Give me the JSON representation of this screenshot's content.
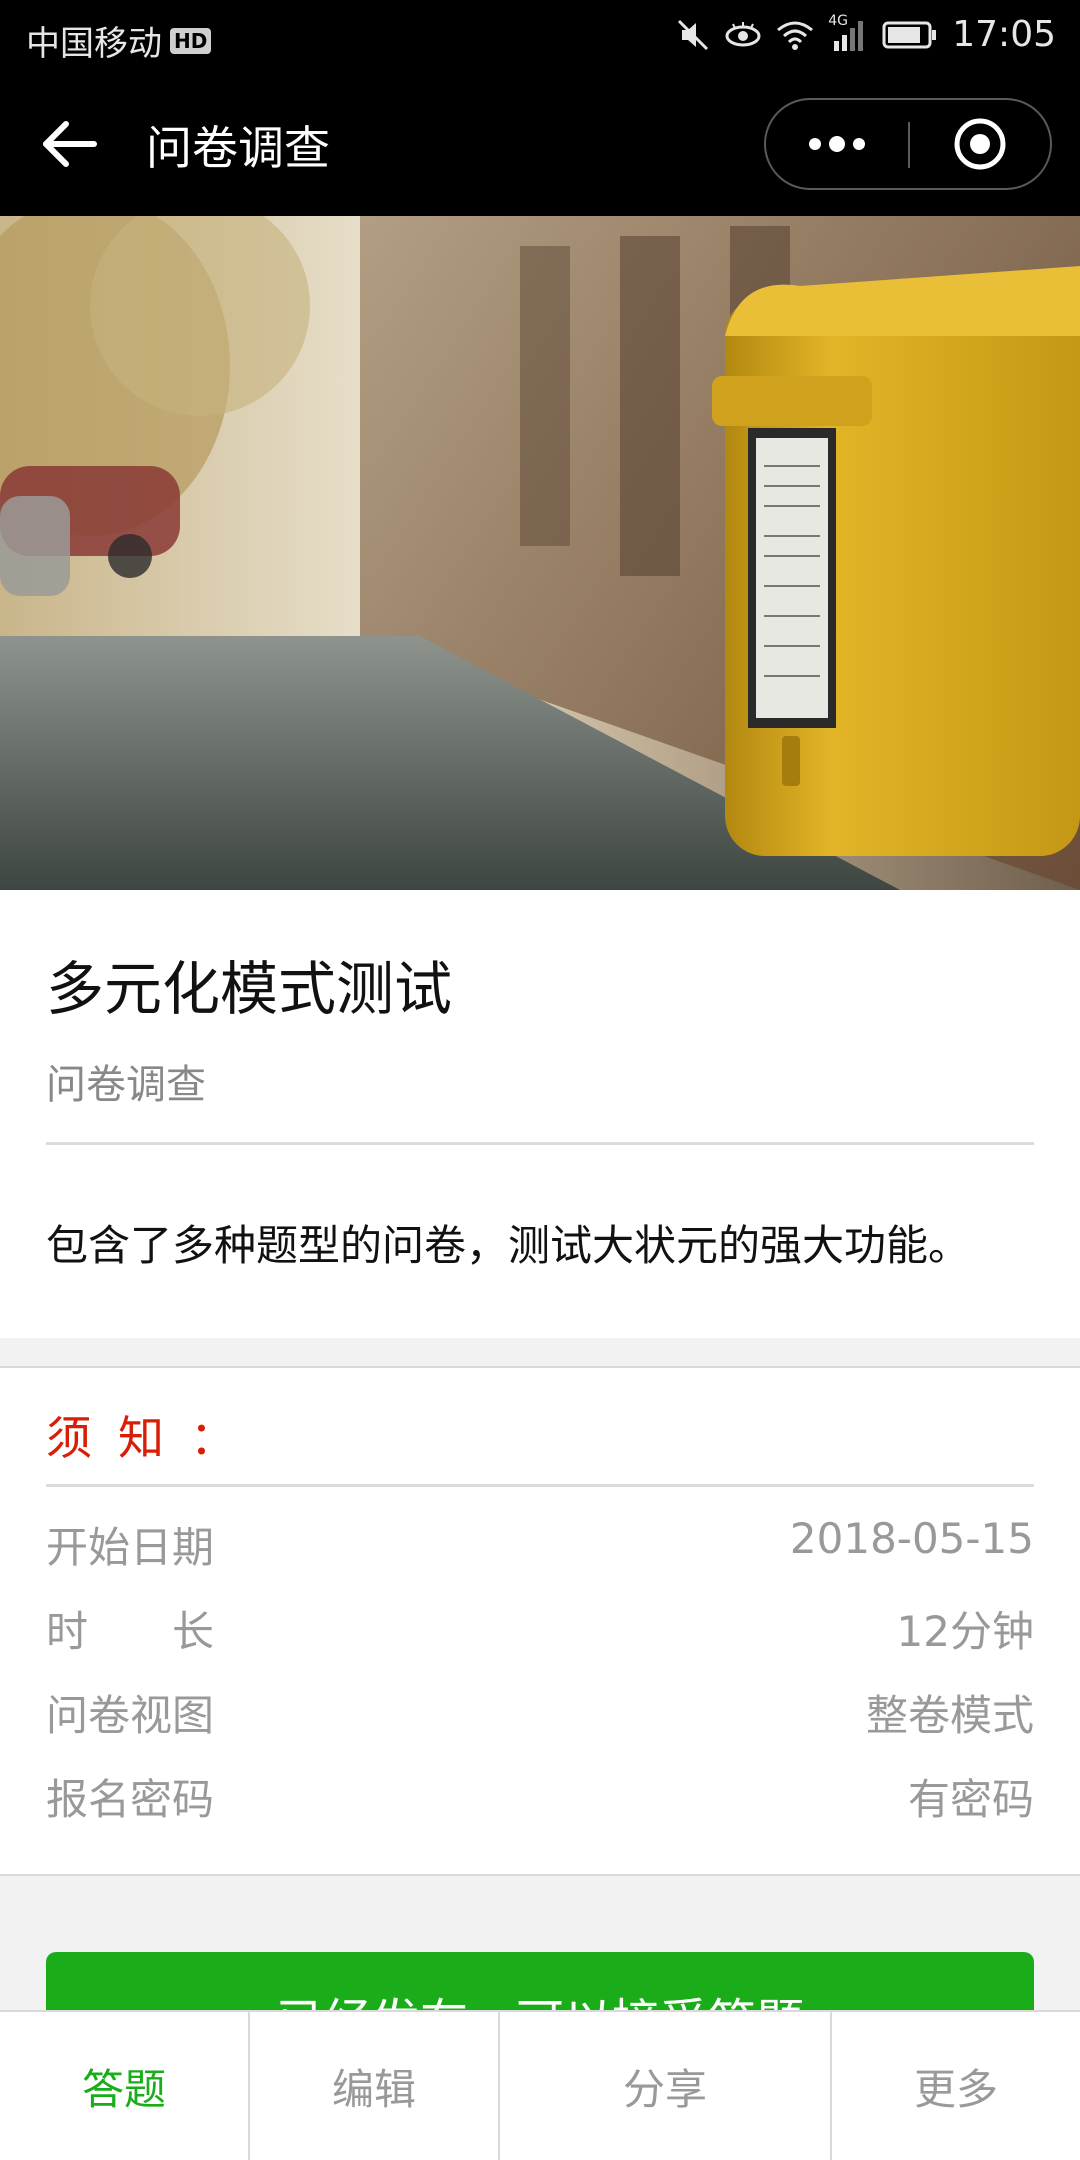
{
  "status_bar": {
    "carrier": "中国移动",
    "hd_badge": "HD",
    "network": "4G",
    "time": "17:05",
    "icons": [
      "mute-icon",
      "eye-icon",
      "wifi-icon",
      "signal-icon",
      "battery-icon"
    ]
  },
  "nav": {
    "title": "问卷调查",
    "icons": [
      "back-arrow-icon",
      "more-dots-icon",
      "close-target-icon"
    ]
  },
  "banner": {
    "image": "yellow mailbox on street"
  },
  "survey": {
    "title": "多元化模式测试",
    "subtitle": "问卷调查",
    "description": "包含了多种题型的问卷，测试大状元的强大功能。"
  },
  "notice": {
    "title": "须知：",
    "rows": [
      {
        "label": "开始日期",
        "value": "2018-05-15"
      },
      {
        "label": "时长",
        "value": "12分钟"
      },
      {
        "label": "问卷视图",
        "value": "整卷模式"
      },
      {
        "label": "报名密码",
        "value": "有密码"
      }
    ]
  },
  "publish_button": {
    "label": "已经发布，可以接受答题"
  },
  "tabs": [
    {
      "label": "答题",
      "active": true
    },
    {
      "label": "编辑",
      "active": false
    },
    {
      "label": "分享",
      "active": false
    },
    {
      "label": "更多",
      "active": false
    }
  ],
  "colors": {
    "accent_green": "#1aad19",
    "notice_red": "#d81e06",
    "mailbox_yellow": "#d9a81e"
  }
}
